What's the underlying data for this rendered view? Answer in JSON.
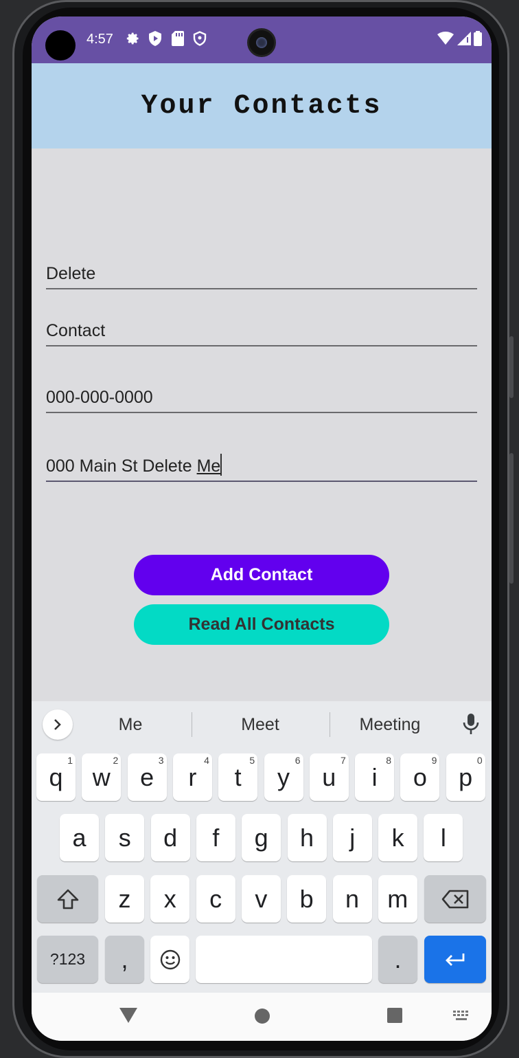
{
  "status_bar": {
    "time": "4:57"
  },
  "header": {
    "title": "Your Contacts"
  },
  "form": {
    "first_name": "Delete",
    "last_name": "Contact",
    "phone": "000-000-0000",
    "address_prefix": "000 Main St Delete ",
    "address_composing": "Me"
  },
  "buttons": {
    "add": "Add Contact",
    "read": "Read All Contacts"
  },
  "keyboard": {
    "suggestions": [
      "Me",
      "Meet",
      "Meeting"
    ],
    "row1": [
      {
        "k": "q",
        "h": "1"
      },
      {
        "k": "w",
        "h": "2"
      },
      {
        "k": "e",
        "h": "3"
      },
      {
        "k": "r",
        "h": "4"
      },
      {
        "k": "t",
        "h": "5"
      },
      {
        "k": "y",
        "h": "6"
      },
      {
        "k": "u",
        "h": "7"
      },
      {
        "k": "i",
        "h": "8"
      },
      {
        "k": "o",
        "h": "9"
      },
      {
        "k": "p",
        "h": "0"
      }
    ],
    "row2": [
      "a",
      "s",
      "d",
      "f",
      "g",
      "h",
      "j",
      "k",
      "l"
    ],
    "row3": [
      "z",
      "x",
      "c",
      "v",
      "b",
      "n",
      "m"
    ],
    "symbols_label": "?123",
    "comma": ",",
    "period": "."
  },
  "colors": {
    "status_bar": "#6750a4",
    "header": "#b4d3ec",
    "add_button": "#6200ee",
    "read_button": "#03dac5",
    "enter_key": "#1a73e8"
  }
}
